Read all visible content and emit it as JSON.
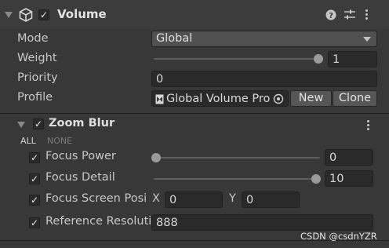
{
  "component": {
    "title": "Volume",
    "help_icon": "help-icon",
    "preset_icon": "preset-icon",
    "menu_icon": "kebab-menu-icon"
  },
  "fields": {
    "mode_label": "Mode",
    "mode_value": "Global",
    "weight_label": "Weight",
    "weight_value": "1",
    "weight_fraction": 1.0,
    "priority_label": "Priority",
    "priority_value": "0",
    "profile_label": "Profile",
    "profile_value": "Global Volume Pro",
    "new_label": "New",
    "clone_label": "Clone"
  },
  "override": {
    "title": "Zoom Blur",
    "all_label": "ALL",
    "none_label": "NONE",
    "focus_power_label": "Focus Power",
    "focus_power_value": "0",
    "focus_power_fraction": 0.0,
    "focus_detail_label": "Focus Detail",
    "focus_detail_value": "10",
    "focus_detail_fraction": 1.0,
    "focus_screen_label": "Focus Screen Posi",
    "x_label": "X",
    "x_value": "0",
    "y_label": "Y",
    "y_value": "0",
    "ref_res_label": "Reference Resoluti",
    "ref_res_value": "888"
  },
  "watermark": "CSDN @csdnYZR"
}
